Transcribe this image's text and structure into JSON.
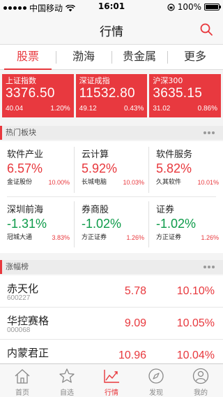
{
  "status_bar": {
    "carrier": "中国移动",
    "time": "16:01",
    "battery": "100%",
    "battery_level": 1.0
  },
  "header": {
    "title": "行情",
    "search_icon": "search-icon"
  },
  "segments": [
    {
      "label": "股票",
      "active": true
    },
    {
      "label": "渤海",
      "active": false
    },
    {
      "label": "贵金属",
      "active": false
    },
    {
      "label": "更多",
      "active": false
    }
  ],
  "indices": [
    {
      "name": "上证指数",
      "value": "3376.50",
      "change": "40.04",
      "pct": "1.20%"
    },
    {
      "name": "深证成指",
      "value": "11532.80",
      "change": "49.12",
      "pct": "0.43%"
    },
    {
      "name": "沪深300",
      "value": "3635.15",
      "change": "31.02",
      "pct": "0.86%"
    }
  ],
  "hot_sectors": {
    "title": "热门板块",
    "items": [
      {
        "name": "软件产业",
        "pct": "6.57%",
        "dir": "up",
        "stock": "金证股份",
        "stock_pct": "10.00%"
      },
      {
        "name": "云计算",
        "pct": "5.92%",
        "dir": "up",
        "stock": "长城电脑",
        "stock_pct": "10.03%"
      },
      {
        "name": "软件服务",
        "pct": "5.82%",
        "dir": "up",
        "stock": "久其软件",
        "stock_pct": "10.01%"
      },
      {
        "name": "深圳前海",
        "pct": "-1.31%",
        "dir": "down",
        "stock": "冠城大通",
        "stock_pct": "3.83%"
      },
      {
        "name": "券商股",
        "pct": "-1.02%",
        "dir": "down",
        "stock": "方正证券",
        "stock_pct": "1.26%"
      },
      {
        "name": "证券",
        "pct": "-1.02%",
        "dir": "down",
        "stock": "方正证券",
        "stock_pct": "1.26%"
      }
    ]
  },
  "gainers": {
    "title": "涨幅榜",
    "rows": [
      {
        "name": "赤天化",
        "code": "600227",
        "price": "5.78",
        "change": "10.10%"
      },
      {
        "name": "华控赛格",
        "code": "000068",
        "price": "9.09",
        "change": "10.05%"
      },
      {
        "name": "内蒙君正",
        "code": "",
        "price": "10.96",
        "change": "10.04%"
      }
    ]
  },
  "tab_bar": [
    {
      "label": "首页",
      "icon": "home-icon",
      "active": false
    },
    {
      "label": "自选",
      "icon": "star-icon",
      "active": false
    },
    {
      "label": "行情",
      "icon": "chart-icon",
      "active": true
    },
    {
      "label": "发现",
      "icon": "compass-icon",
      "active": false
    },
    {
      "label": "我的",
      "icon": "user-icon",
      "active": false
    }
  ],
  "colors": {
    "accent": "#e8383d",
    "up": "#e8383d",
    "down": "#0e9b4a"
  }
}
